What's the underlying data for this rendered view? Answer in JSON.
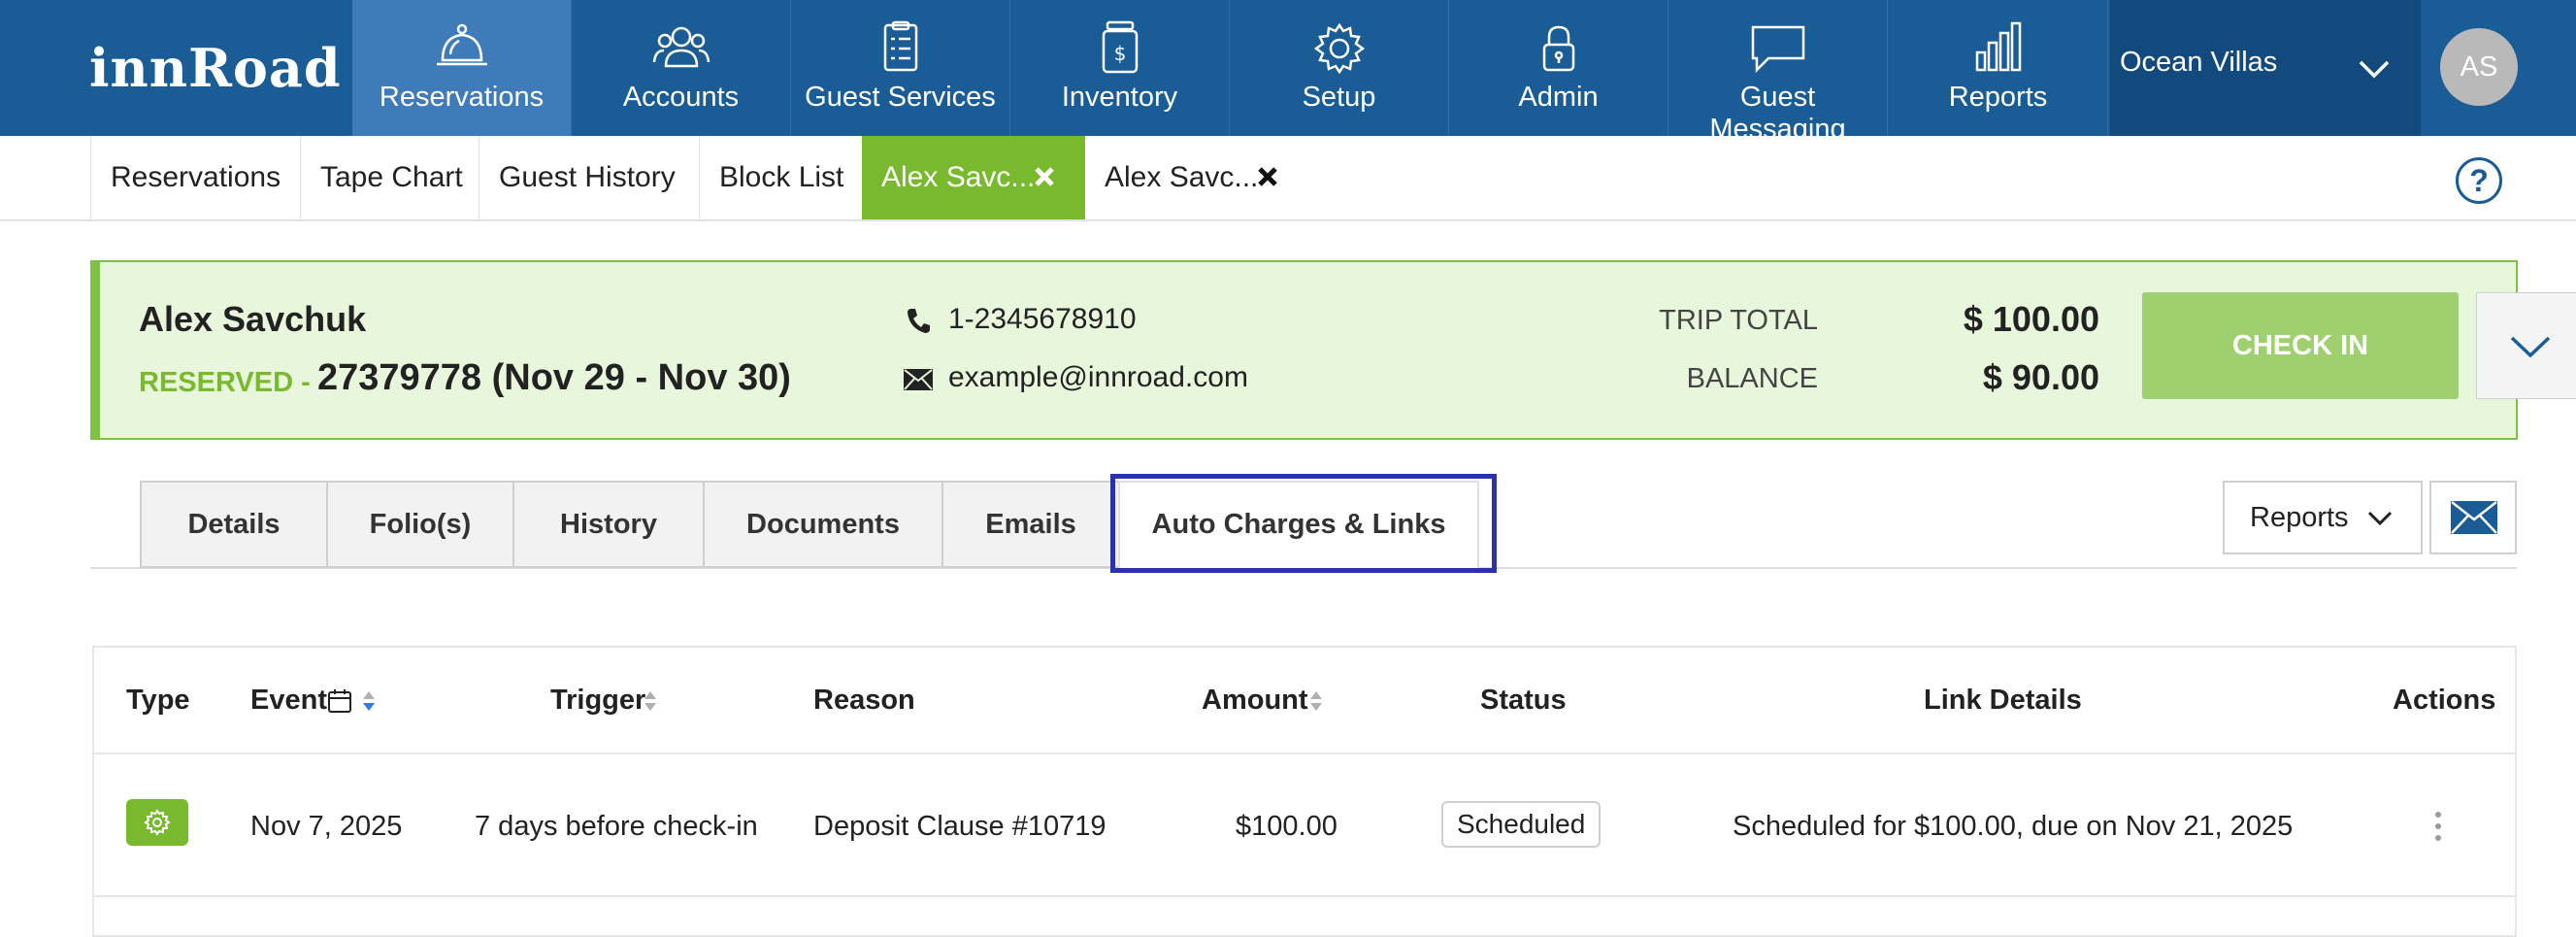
{
  "brand": {
    "logo": "innRoad"
  },
  "nav": {
    "items": [
      {
        "label": "Reservations",
        "icon": "bell-icon"
      },
      {
        "label": "Accounts",
        "icon": "people-icon"
      },
      {
        "label": "Guest Services",
        "icon": "clipboard-icon"
      },
      {
        "label": "Inventory",
        "icon": "dollar-jar-icon"
      },
      {
        "label": "Setup",
        "icon": "gear-icon"
      },
      {
        "label": "Admin",
        "icon": "lock-icon"
      },
      {
        "label": "Guest Messaging",
        "icon": "chat-icon"
      },
      {
        "label": "Reports",
        "icon": "bar-chart-icon"
      }
    ],
    "active": "Reservations",
    "property": "Ocean Villas",
    "avatar_initials": "AS"
  },
  "subtabs": [
    {
      "label": "Reservations"
    },
    {
      "label": "Tape Chart"
    },
    {
      "label": "Guest History"
    },
    {
      "label": "Block List"
    },
    {
      "label": "Alex Savc...",
      "closable": true,
      "active": true
    },
    {
      "label": "Alex Savc...",
      "closable": true
    }
  ],
  "help": "?",
  "reservation": {
    "guest_name": "Alex Savchuk",
    "status_label": "RESERVED -",
    "number_dates": "27379778 (Nov 29 - Nov 30)",
    "phone": "1-2345678910",
    "email": "example@innroad.com",
    "trip_total_label": "TRIP TOTAL",
    "trip_total": "$ 100.00",
    "balance_label": "BALANCE",
    "balance": "$ 90.00",
    "checkin_label": "CHECK IN"
  },
  "res_tabs": [
    "Details",
    "Folio(s)",
    "History",
    "Documents",
    "Emails",
    "Auto Charges & Links"
  ],
  "active_res_tab": "Auto Charges & Links",
  "reports_button": "Reports",
  "table": {
    "headers": {
      "type": "Type",
      "event": "Event",
      "trigger": "Trigger",
      "reason": "Reason",
      "amount": "Amount",
      "status": "Status",
      "link_details": "Link Details",
      "actions": "Actions"
    },
    "rows": [
      {
        "type_icon": "gear-icon",
        "event": "Nov 7, 2025",
        "trigger": "7 days before check-in",
        "reason": "Deposit Clause #10719",
        "amount": "$100.00",
        "status": "Scheduled",
        "link_details": "Scheduled for $100.00, due on Nov 21, 2025"
      }
    ]
  },
  "colors": {
    "nav_bg": "#1a5c96",
    "nav_active": "#3f7bb8",
    "accent_green": "#79b92e",
    "res_bg": "#e8f6dc",
    "checkin_bg": "#9ed06f",
    "highlight": "#2932a8"
  }
}
